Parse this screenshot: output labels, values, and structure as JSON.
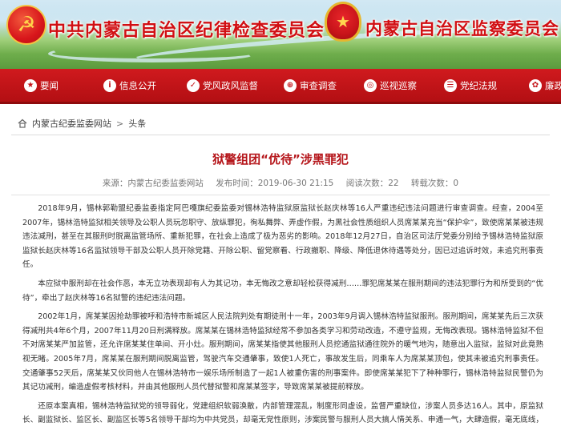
{
  "header": {
    "party_emblem_icon": "hammer-sickle-icon",
    "title_left": "中共内蒙古自治区纪律检查委员会",
    "state_emblem_icon": "national-emblem-icon",
    "title_right": "内蒙古自治区监察委员会"
  },
  "nav": {
    "items": [
      {
        "label": "要闻",
        "icon": "★"
      },
      {
        "label": "信息公开",
        "icon": "i"
      },
      {
        "label": "党风政风监督",
        "icon": "✓"
      },
      {
        "label": "审查调查",
        "icon": "⊕"
      },
      {
        "label": "巡视巡察",
        "icon": "◎"
      },
      {
        "label": "党纪法规",
        "icon": "☰"
      },
      {
        "label": "廉政文化",
        "icon": "✿"
      }
    ]
  },
  "breadcrumb": {
    "home_icon": "home-icon",
    "items": [
      "内蒙古纪委监委网站",
      "头条"
    ],
    "separator": ">"
  },
  "article": {
    "title": "狱警组团“优待”涉黑罪犯",
    "source_label": "来源：",
    "source": "内蒙古纪委监委网站",
    "time_label": "发布时间：",
    "time": "2019-06-30 21:15",
    "views_label": "阅读次数：",
    "views": "22",
    "shares_label": "转载次数：",
    "shares": "0",
    "paragraphs": [
      "2018年9月，锡林郭勒盟纪委监委指定阿巴嘎旗纪委监委对锡林浩特监狱原监狱长赵庆林等16人严重违纪违法问题进行审查调查。经查，2004至2007年，锡林浩特监狱相关领导及公职人员玩忽职守、放纵罪犯，徇私舞弊、弄虚作假，为黑社会性质组织人员席某某充当“保护伞”，致使席某某被违规违法减刑，甚至在其服刑时脱离监管场所、重新犯罪，在社会上造成了极为恶劣的影响。2018年12月27日，自治区司法厅党委分别给予锡林浩特监狱原监狱长赵庆林等16名监狱领导干部及公职人员开除党籍、开除公职、留党察看、行政撤职、降级、降低退休待遇等处分，因已过追诉时效，未追究刑事责任。",
      "本应狱中服刑却在社会作恶，本无立功表现却有人为其记功，本无悔改之意却轻松获得减刑……罪犯席某某在服刑期间的违法犯罪行为和所受到的“优待”，牵出了赵庆林等16名狱警的违纪违法问题。",
      "2002年1月，席某某因抢劫罪被呼和浩特市新城区人民法院判处有期徒刑十一年，2003年9月调入锡林浩特监狱服刑。服刑期间，席某某先后三次获得减刑共4年6个月，2007年11月20日刑满释放。席某某在锡林浩特监狱经常不参加各类学习和劳动改造，不遵守监规，无悔改表现。锡林浩特监狱不但不对席某某严加监管，还允许席某某住单间、开小灶。服刑期间，席某某指使其他服刑人员挖通监狱通往院外的暖气地沟，随意出入监狱，监狱对此竟熟视无睹。2005年7月，席某某在服刑期间脱离监管，驾驶汽车交通肇事，致使1人死亡，事故发生后，同乘车人为席某某顶包，使其未被追究刑事责任。交通肇事52天后，席某某又伙同他人在锡林浩特市一娱乐场所制造了一起1人被重伤害的刑事案件。即使席某某犯下了种种罪行，锡林浩特监狱民警仍为其记功减刑，编造虚假考核材料，并由其他服刑人员代替狱警和席某某签字，导致席某某被提前释放。",
      "还原本案真相，锡林浩特监狱党的领导弱化，党建组织软弱涣散，内部管理混乱，制度形同虚设，监督严重缺位，涉案人员多达16人。其中，原监狱长、副监狱长、监区长、副监区长等5名领导干部均为中共党员，却毫无党性原则，涉案民警与服刑人员大搞人情关系、申通一气，大肆造假，毫无底线，目无法纪，擅权枉法，触目惊心，令人发指。"
    ]
  }
}
